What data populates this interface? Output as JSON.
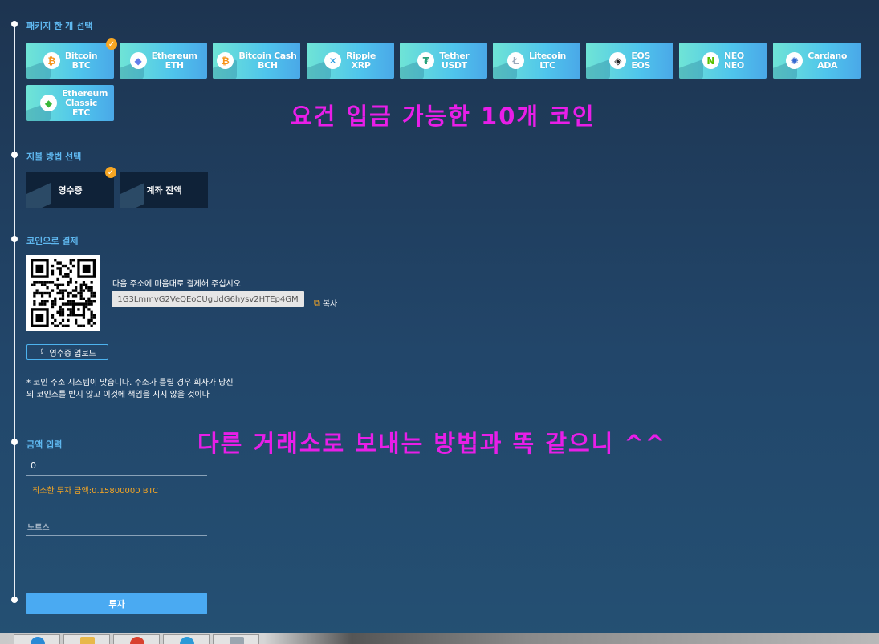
{
  "sections": {
    "package": "패키지 한 개 선택",
    "payment_method": "지불 방법 선택",
    "pay_with_coin": "코인으로 결제",
    "amount_input": "금액 입력"
  },
  "coins": [
    {
      "name": "Bitcoin",
      "symbol": "BTC",
      "icon": "bitcoin-icon",
      "color": "#f7931a",
      "selected": true
    },
    {
      "name": "Ethereum",
      "symbol": "ETH",
      "icon": "ethereum-icon",
      "color": "#627eea"
    },
    {
      "name": "Bitcoin Cash",
      "symbol": "BCH",
      "icon": "bitcoin-cash-icon",
      "color": "#f7931a"
    },
    {
      "name": "Ripple",
      "symbol": "XRP",
      "icon": "ripple-icon",
      "color": "#2a9ce0"
    },
    {
      "name": "Tether",
      "symbol": "USDT",
      "icon": "tether-icon",
      "color": "#26a17b"
    },
    {
      "name": "Litecoin",
      "symbol": "LTC",
      "icon": "litecoin-icon",
      "color": "#9aa9bb"
    },
    {
      "name": "EOS",
      "symbol": "EOS",
      "icon": "eos-icon",
      "color": "#222222"
    },
    {
      "name": "NEO",
      "symbol": "NEO",
      "icon": "neo-icon",
      "color": "#58bf00"
    },
    {
      "name": "Cardano",
      "symbol": "ADA",
      "icon": "cardano-icon",
      "color": "#3468d1"
    },
    {
      "name": "Ethereum Classic",
      "symbol": "ETC",
      "icon": "ethereum-classic-icon",
      "color": "#3ab83a"
    }
  ],
  "payment_methods": [
    {
      "label": "영수증",
      "selected": true
    },
    {
      "label": "계좌 잔액",
      "selected": false
    }
  ],
  "overlay": {
    "coins_note": "요건 입금 가능한 10개 코인",
    "exchange_note": "다른 거래소로 보내는 방법과 똑 같으니 ^^"
  },
  "payment": {
    "instruction": "다음 주소에 마음대로 결제해 주십시오",
    "address": "1G3LmmvG2VeQEoCUgUdG6hysv2HTEp4GM",
    "copy_label": "복사",
    "upload_label": "영수증 업로드",
    "notice": "* 코인 주소 시스템이 맞습니다. 주소가 틀릴 경우 회사가 당신의 코인스를 받지 않고 이것에 책임을 지지 않을 것이다"
  },
  "amount": {
    "value": "0",
    "min_text": "최소한 투자 금액:0.15800000 BTC",
    "notes_placeholder": "노트스"
  },
  "invest_button": "투자"
}
